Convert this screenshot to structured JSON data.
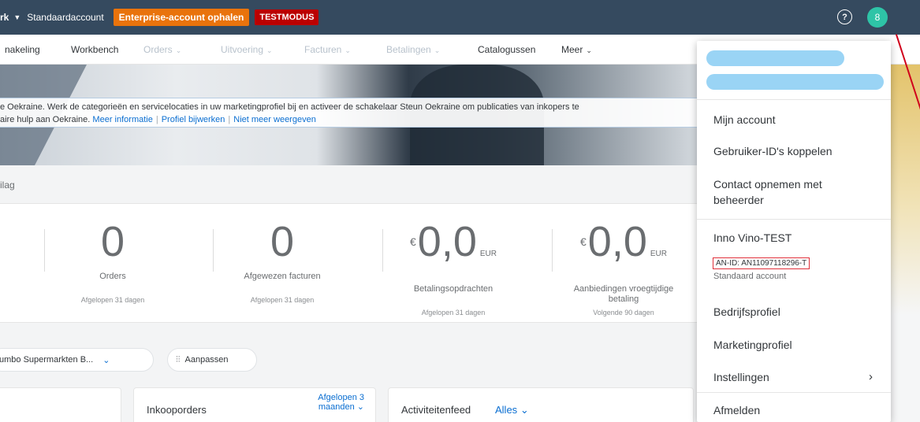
{
  "shellbar": {
    "brand": "rk",
    "account": "Standaardaccount",
    "enterprise_button": "Enterprise-account ophalen",
    "test_badge": "TESTMODUS",
    "help_icon": "help-icon",
    "avatar_initial": "8"
  },
  "nav": {
    "items": [
      {
        "label": "nakeling",
        "muted": false
      },
      {
        "label": "Workbench",
        "muted": false
      },
      {
        "label": "Orders",
        "muted": true
      },
      {
        "label": "Uitvoering",
        "muted": true
      },
      {
        "label": "Facturen",
        "muted": true
      },
      {
        "label": "Betalingen",
        "muted": true
      },
      {
        "label": "Catalogussen",
        "muted": false
      },
      {
        "label": "Meer",
        "muted": false
      }
    ]
  },
  "banner": {
    "line1": "e Oekraine. Werk de categorieën en servicelocaties in uw marketingprofiel bij en activeer de schakelaar Steun Oekraine om publicaties van inkopers te",
    "line2": "aire hulp aan Oekraine.",
    "link_more": "Meer informatie",
    "link_profile": "Profiel bijwerken",
    "link_hide": "Niet meer weergeven"
  },
  "section_label": "ilag",
  "kpis": [
    {
      "value": "0",
      "currency": "",
      "unit": "",
      "label": "Orders",
      "period": "Afgelopen 31 dagen"
    },
    {
      "value": "0",
      "currency": "",
      "unit": "",
      "label": "Afgewezen facturen",
      "period": "Afgelopen 31 dagen"
    },
    {
      "value": "0,0",
      "currency": "€",
      "unit": "EUR",
      "label": "Betalingsopdrachten",
      "period": "Afgelopen 31 dagen"
    },
    {
      "value": "0,0",
      "currency": "€",
      "unit": "EUR",
      "label": "Aanbiedingen vroegtijdige betaling",
      "period": "Volgende 90 dagen"
    }
  ],
  "filters": {
    "customer": "umbo Supermarkten B...",
    "customize": "Aanpassen"
  },
  "cards": {
    "purchase_orders": {
      "title": "Inkooporders",
      "period_line1": "Afgelopen 3",
      "period_line2": "maanden"
    },
    "activity": {
      "title": "Activiteitenfeed",
      "filter": "Alles"
    }
  },
  "menu": {
    "items": {
      "my_account": "Mijn account",
      "link_ids": "Gebruiker-ID's koppelen",
      "contact_line1": "Contact opnemen met",
      "contact_line2": "beheerder",
      "company": "Inno Vino-TEST",
      "an_id": "AN-ID: AN11097118296-T",
      "account_type": "Standaard account",
      "company_profile": "Bedrijfsprofiel",
      "marketing_profile": "Marketingprofiel",
      "settings": "Instellingen",
      "logout": "Afmelden"
    }
  },
  "colors": {
    "shell": "#354a5f",
    "enterprise": "#e9730c",
    "test": "#bb0000",
    "link": "#0a6ed1",
    "avatar": "#2ec4a7",
    "highlight": "#e0303a"
  }
}
